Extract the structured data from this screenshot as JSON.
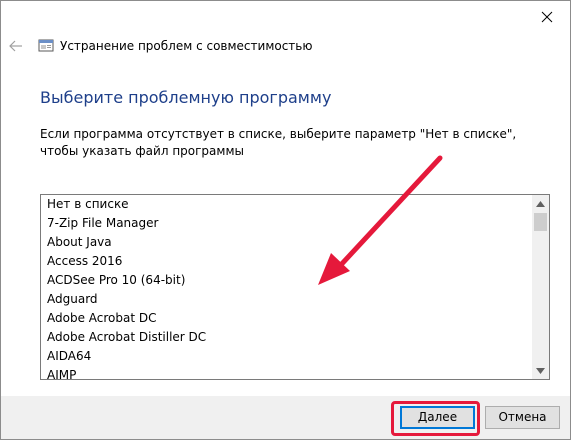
{
  "window": {
    "title": "Устранение проблем с совместимостью",
    "close_glyph": "✕",
    "back_glyph": "←"
  },
  "page": {
    "heading": "Выберите проблемную программу",
    "description": "Если программа отсутствует в списке, выберите параметр \"Нет в списке\", чтобы указать файл программы"
  },
  "program_list": {
    "items": [
      "Нет в списке",
      "7-Zip File Manager",
      "About Java",
      "Access 2016",
      "ACDSee Pro 10 (64-bit)",
      "Adguard",
      "Adobe Acrobat DC",
      "Adobe Acrobat Distiller DC",
      "AIDA64",
      "AIMP"
    ]
  },
  "buttons": {
    "next_label": "Далее",
    "cancel_label": "Отмена"
  },
  "annotation": {
    "arrow_color": "#e5193b",
    "highlight_color": "#e5193b"
  },
  "colors": {
    "heading": "#1e3f8a",
    "focus_border": "#0078d7",
    "footer_bg": "#f0f0f0"
  }
}
